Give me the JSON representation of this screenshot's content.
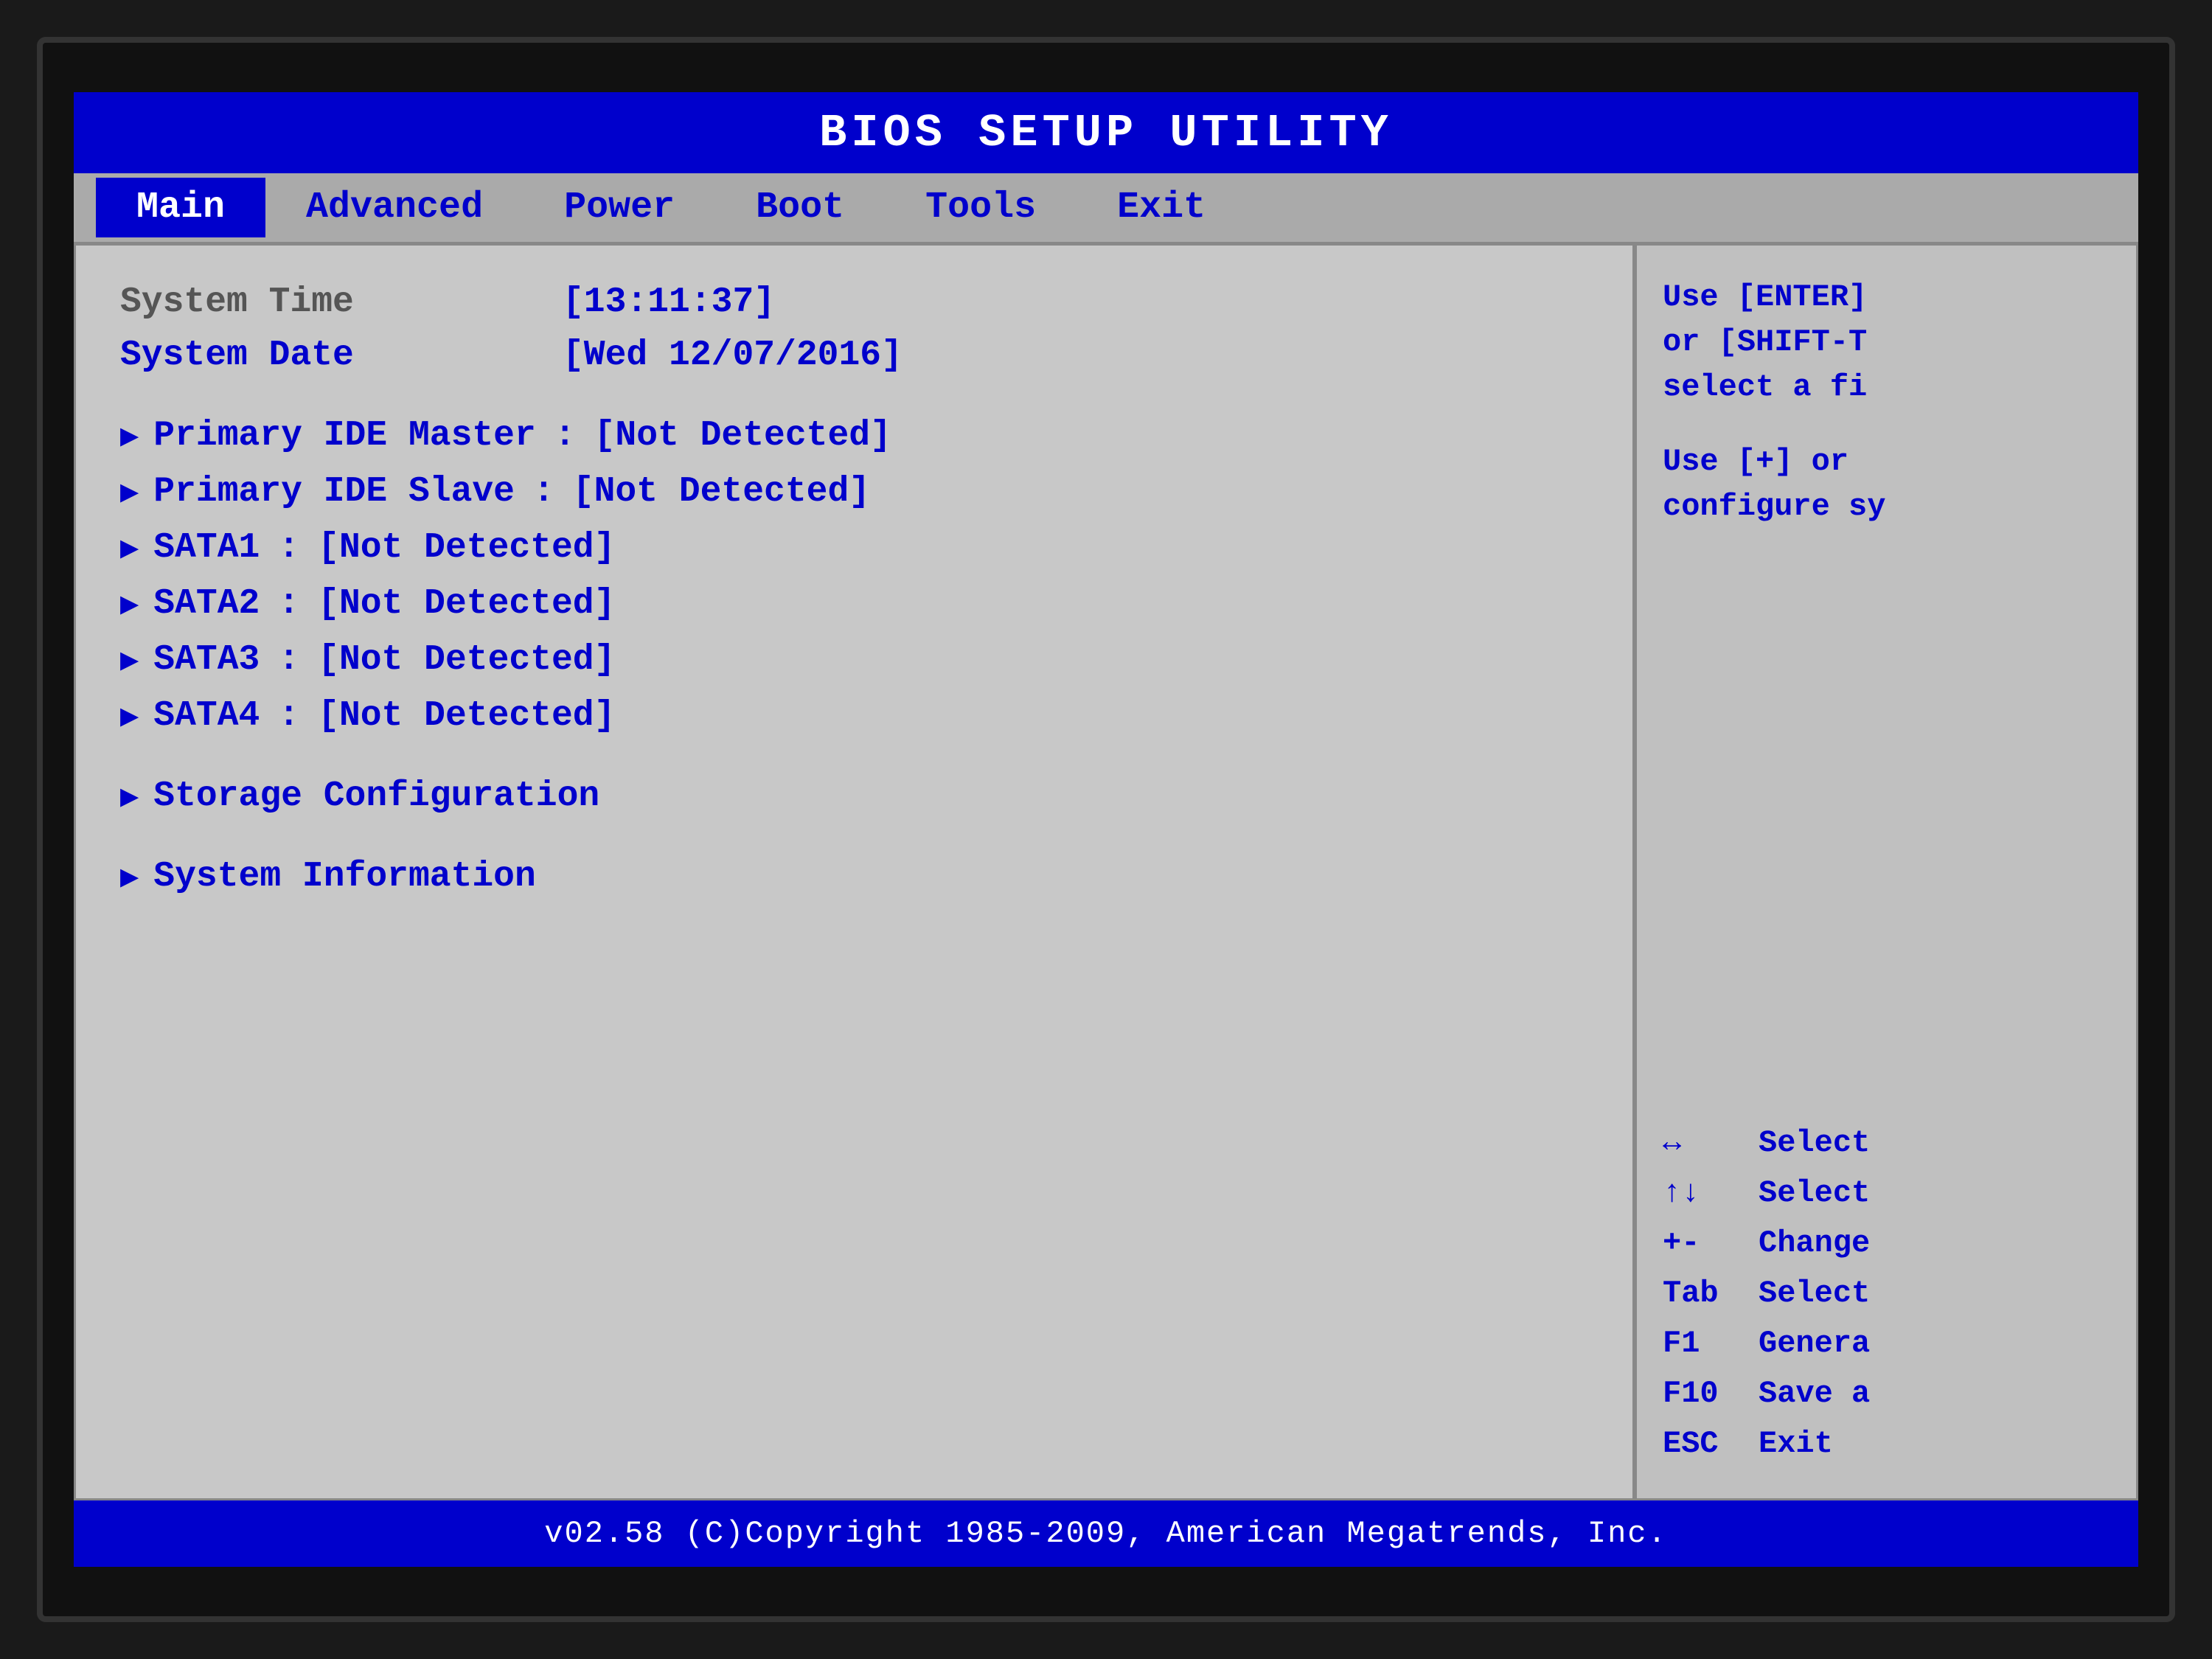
{
  "title_bar": {
    "text": "BIOS  SETUP  UTILITY"
  },
  "nav": {
    "items": [
      {
        "label": "Main",
        "active": true
      },
      {
        "label": "Advanced",
        "active": false
      },
      {
        "label": "Power",
        "active": false
      },
      {
        "label": "Boot",
        "active": false
      },
      {
        "label": "Tools",
        "active": false
      },
      {
        "label": "Exit",
        "active": false
      }
    ]
  },
  "main_panel": {
    "system_time_label": "System Time",
    "system_time_value": "[13:11:37]",
    "system_date_label": "System Date",
    "system_date_value": "[Wed 12/07/2016]",
    "drives": [
      {
        "label": "Primary IDE Master",
        "value": "[Not Detected]"
      },
      {
        "label": "Primary IDE Slave",
        "value": "[Not Detected]"
      },
      {
        "label": "SATA1",
        "value": "[Not Detected]"
      },
      {
        "label": "SATA2",
        "value": "[Not Detected]"
      },
      {
        "label": "SATA3",
        "value": "[Not Detected]"
      },
      {
        "label": "SATA4",
        "value": "[Not Detected]"
      }
    ],
    "submenu_items": [
      {
        "label": "Storage Configuration"
      },
      {
        "label": "System Information"
      }
    ]
  },
  "help_panel": {
    "help_text_1": "Use [ENTER]",
    "help_text_2": "or [SHIFT-T",
    "help_text_3": "select a fi",
    "help_text_4": "Use [+] or",
    "help_text_5": "configure sy",
    "keys": [
      {
        "symbol": "↔",
        "desc": "Select"
      },
      {
        "symbol": "↑↓",
        "desc": "Select"
      },
      {
        "symbol": "+-",
        "desc": "Change"
      },
      {
        "symbol": "Tab",
        "desc": "Select"
      },
      {
        "symbol": "F1",
        "desc": "Genera"
      },
      {
        "symbol": "F10",
        "desc": "Save a"
      },
      {
        "symbol": "ESC",
        "desc": "Exit"
      }
    ]
  },
  "footer": {
    "text": "v02.58  (C)Copyright 1985-2009, American Megatrends, Inc."
  }
}
